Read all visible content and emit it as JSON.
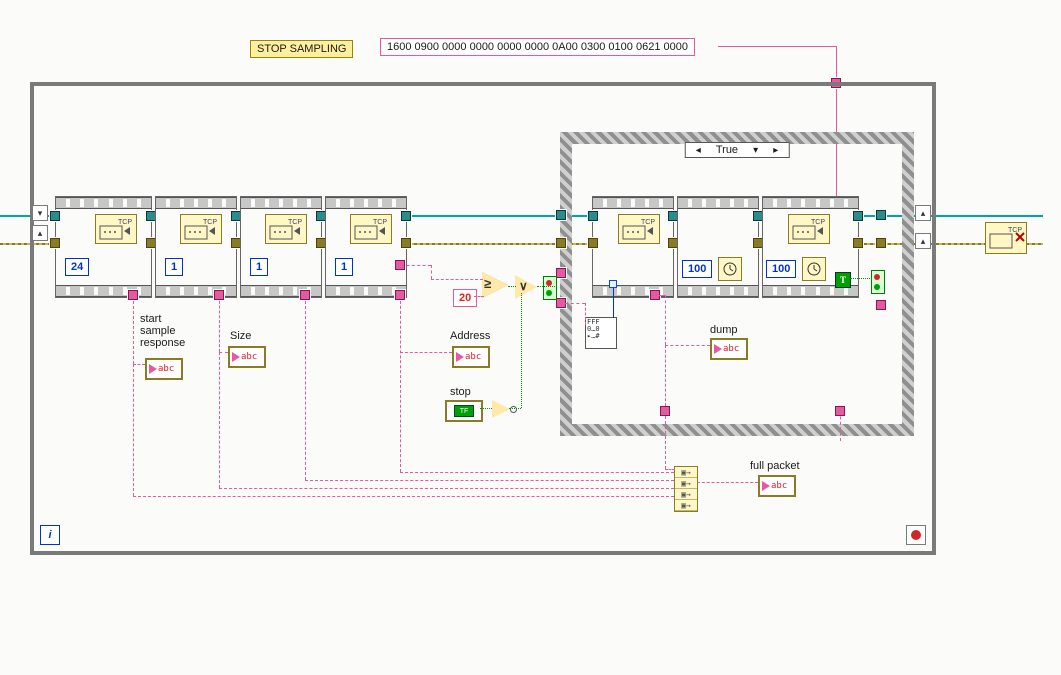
{
  "labels": {
    "stop_sampling": "STOP SAMPLING",
    "packet": "1600 0900 0000 0000 0000 0000 0A00 0300 0100 0621 0000",
    "start_sample_response": "start\nsample\nresponse",
    "size": "Size",
    "address": "Address",
    "stop": "stop",
    "dump": "dump",
    "full_packet": "full packet"
  },
  "constants": {
    "n24": "24",
    "n1a": "1",
    "n1b": "1",
    "n1c": "1",
    "n20": "20",
    "n100a": "100",
    "n100b": "100",
    "bool_true": "T"
  },
  "case_selector": "True",
  "while_i": "i",
  "cluster_txt": "FFF\n0…0\n▸…#",
  "tcp_caption": "TCP"
}
